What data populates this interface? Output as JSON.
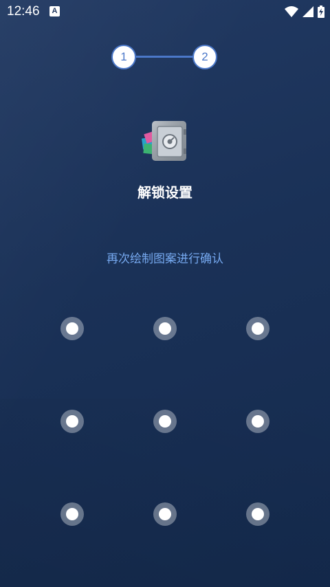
{
  "status_bar": {
    "time": "12:46",
    "notification_label": "A",
    "icons": [
      "wifi-icon",
      "cell-signal-icon",
      "battery-charging-icon"
    ]
  },
  "stepper": {
    "step1": "1",
    "step2": "2",
    "active_color": "#4b78c9"
  },
  "app": {
    "logo_icon": "safe-vault-icon"
  },
  "title": "解锁设置",
  "instruction": "再次绘制图案进行确认",
  "pattern": {
    "dots": [
      1,
      2,
      3,
      4,
      5,
      6,
      7,
      8,
      9
    ]
  },
  "colors": {
    "background": "#1b3259",
    "instruction_text": "#76a9f0"
  }
}
